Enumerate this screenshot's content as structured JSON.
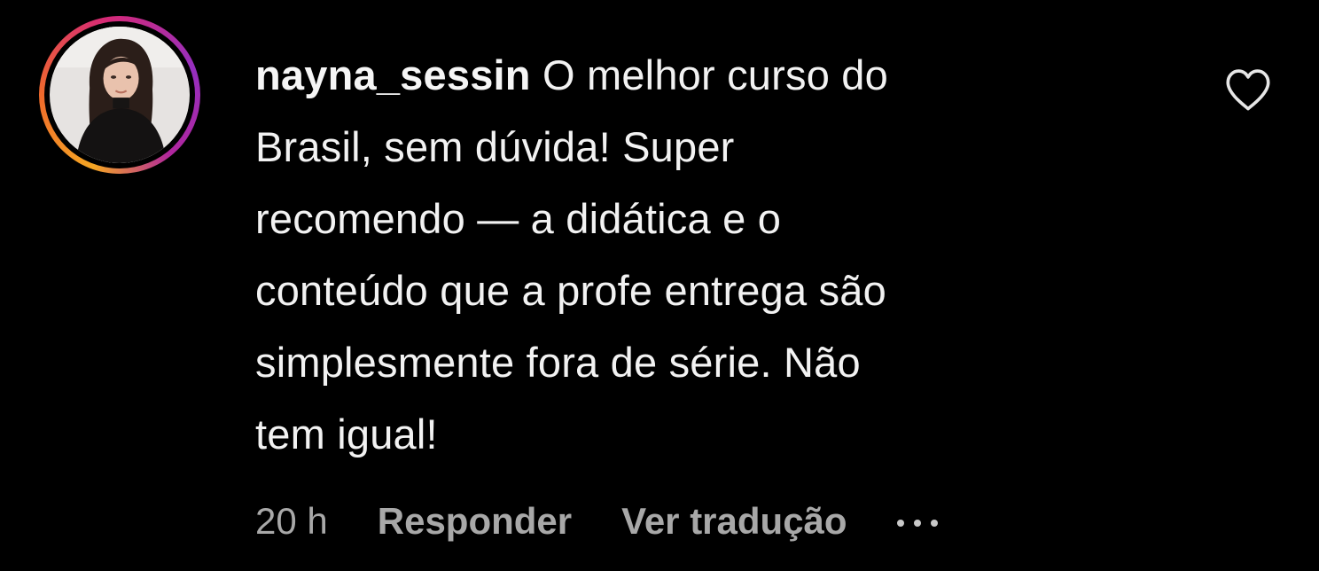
{
  "comment": {
    "username": "nayna_sessin",
    "text_lines": [
      "O melhor curso do",
      "Brasil, sem dúvida! Super",
      "recomendo — a didática e o",
      "conteúdo que a profe entrega são",
      "simplesmente fora de série. Não",
      "tem igual!"
    ],
    "time": "20 h",
    "reply_label": "Responder",
    "translate_label": "Ver tradução",
    "more_icon": "more-horizontal-icon",
    "like_icon": "heart-outline-icon",
    "avatar_icon": "user-avatar"
  },
  "colors": {
    "background": "#000000",
    "text": "#f2f2f2",
    "meta": "#a8a8a8",
    "story_ring_start": "#f5a623",
    "story_ring_end": "#962fbf"
  }
}
